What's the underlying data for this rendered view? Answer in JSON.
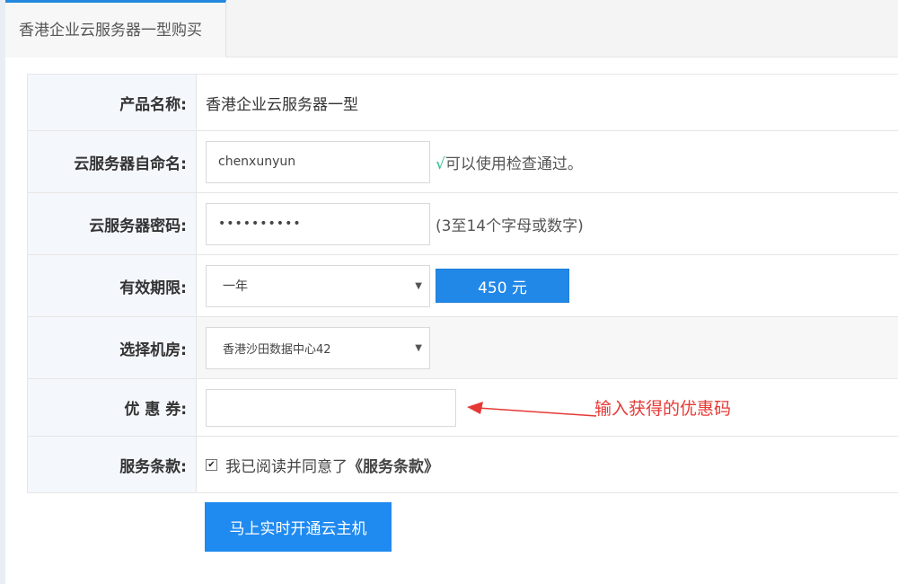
{
  "tab": {
    "label": "香港企业云服务器一型购买"
  },
  "form": {
    "product": {
      "label": "产品名称:",
      "value": "香港企业云服务器一型"
    },
    "server_name": {
      "label": "云服务器自命名:",
      "value": "chenxunyun",
      "check_mark": "√",
      "status": "可以使用检查通过。"
    },
    "password": {
      "label": "云服务器密码:",
      "value": "••••••••••",
      "hint": "(3至14个字母或数字)"
    },
    "period": {
      "label": "有效期限:",
      "selected": "一年",
      "price": "450 元"
    },
    "datacenter": {
      "label": "选择机房:",
      "selected": "香港沙田数据中心42"
    },
    "coupon": {
      "label": "优 惠 券:",
      "value": "",
      "annotation": "输入获得的优惠码"
    },
    "terms": {
      "label": "服务条款:",
      "checked": true,
      "check_glyph": "✔",
      "text": "我已阅读并同意了",
      "link": "《服务条款》"
    }
  },
  "submit": {
    "label": "马上实时开通云主机"
  },
  "colors": {
    "accent": "#2288e8",
    "ok": "#2bbf8e",
    "annotation": "#e53935"
  }
}
